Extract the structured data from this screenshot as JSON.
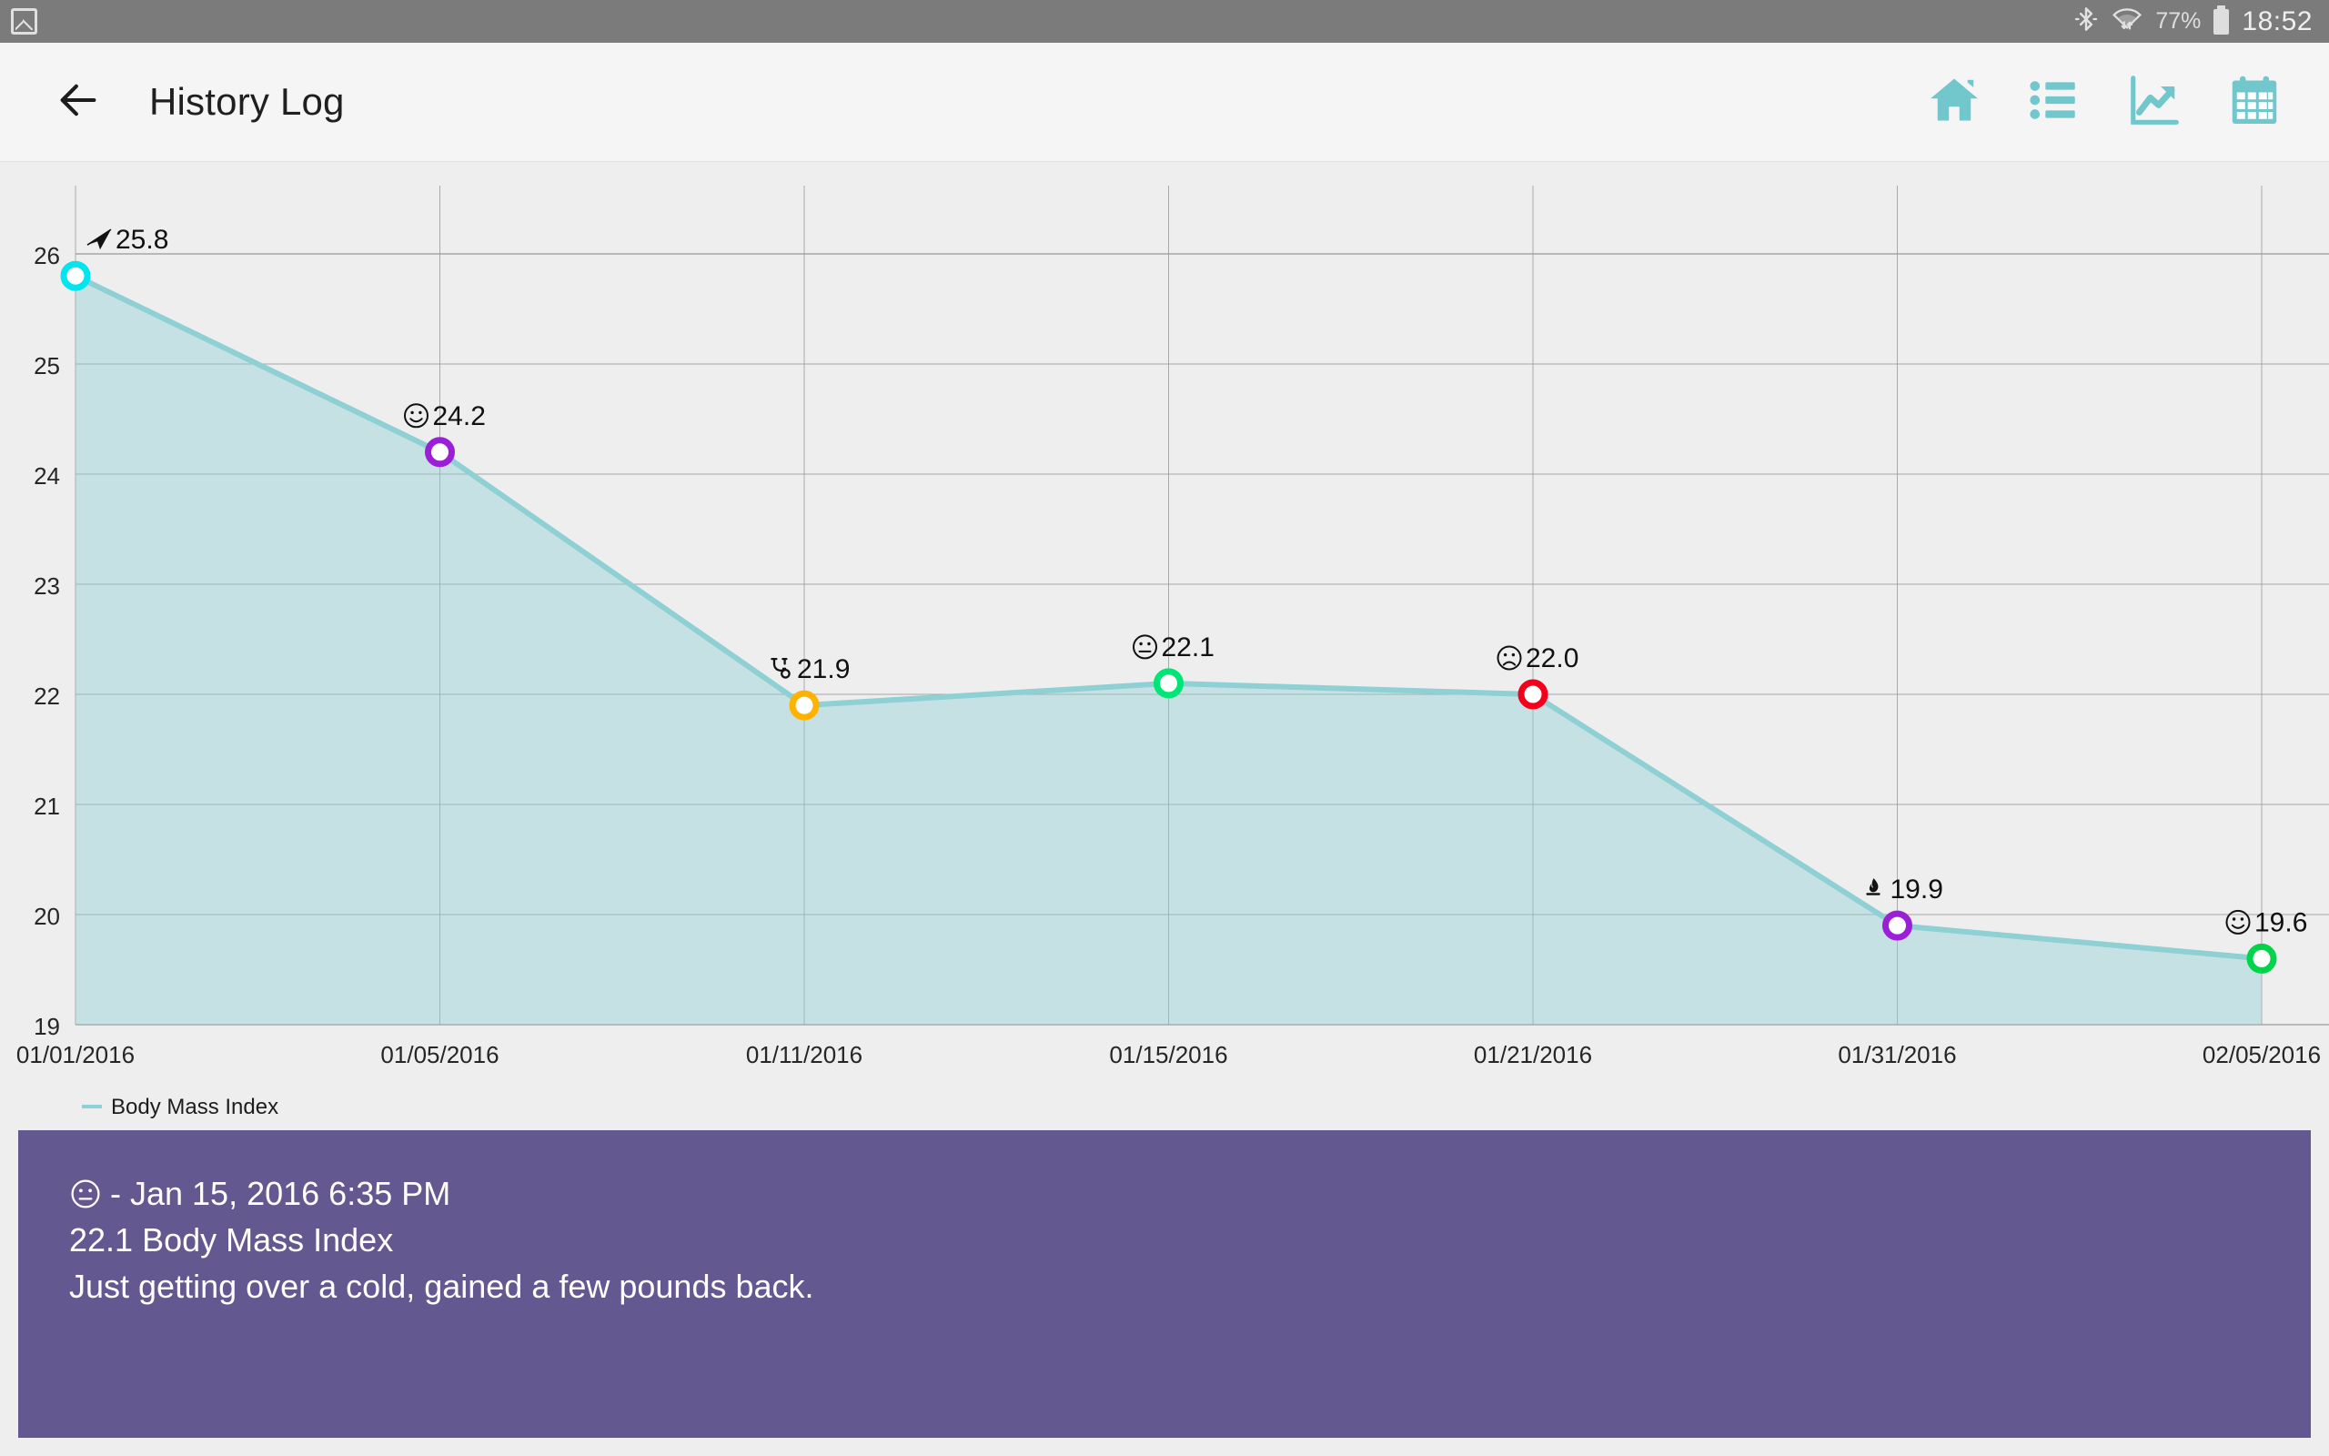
{
  "status_bar": {
    "notification_icon": "image-chart-icon",
    "bluetooth_icon": "bluetooth-icon",
    "wifi_icon": "wifi-icon",
    "battery_percent": "77%",
    "battery_icon": "battery-icon",
    "time": "18:52"
  },
  "app_bar": {
    "back_icon": "back-arrow-icon",
    "title": "History Log",
    "actions": [
      {
        "name": "home-icon",
        "label": "Home"
      },
      {
        "name": "list-icon",
        "label": "List"
      },
      {
        "name": "chart-trending-up-icon",
        "label": "Chart"
      },
      {
        "name": "calendar-icon",
        "label": "Calendar"
      }
    ]
  },
  "colors": {
    "accent_teal": "#72c7cd",
    "line": "#8ed0d3",
    "area_fill": "#c6e3e1",
    "detail_card_bg": "#63588f",
    "status_bar_bg": "#7b7b7b",
    "app_bar_bg": "#f5f5f5",
    "chart_bg": "#eeeeee"
  },
  "chart_data": {
    "type": "line",
    "title": "",
    "xlabel": "",
    "ylabel": "",
    "grid": true,
    "legend_position": "bottom-left",
    "series": [
      {
        "name": "Body Mass Index",
        "color": "#8ed0d3",
        "x": [
          "01/01/2016",
          "01/05/2016",
          "01/11/2016",
          "01/15/2016",
          "01/21/2016",
          "01/31/2016",
          "02/05/2016"
        ],
        "values": [
          25.8,
          24.2,
          21.9,
          22.1,
          22.0,
          19.9,
          19.6
        ],
        "point_labels": [
          "25.8",
          "24.2",
          "21.9",
          "22.1",
          "22.0",
          "19.9",
          "19.6"
        ],
        "point_icons": [
          "paper-plane-icon",
          "smiley-happy-icon",
          "stethoscope-icon",
          "smiley-neutral-icon",
          "smiley-sad-icon",
          "flame-icon",
          "smiley-happy-icon"
        ],
        "point_colors": [
          "#00e5ee",
          "#9b1fd6",
          "#ffb300",
          "#00e676",
          "#f4001a",
          "#9b1fd6",
          "#00d44a"
        ]
      }
    ],
    "x_tick_labels": [
      "01/01/2016",
      "01/05/2016",
      "01/11/2016",
      "01/15/2016",
      "01/21/2016",
      "01/31/2016",
      "02/05/2016"
    ],
    "y_tick_labels": [
      "26",
      "25",
      "24",
      "23",
      "22",
      "21",
      "20",
      "19"
    ],
    "ylim": [
      19,
      26
    ],
    "legend": [
      {
        "label": "Body Mass Index",
        "color": "#8ed0d3"
      }
    ]
  },
  "detail_card": {
    "mood_icon": "smiley-neutral-icon",
    "line1": "- Jan 15, 2016 6:35 PM",
    "line2": "22.1 Body Mass Index",
    "line3": "Just getting over a cold, gained a few pounds back."
  }
}
